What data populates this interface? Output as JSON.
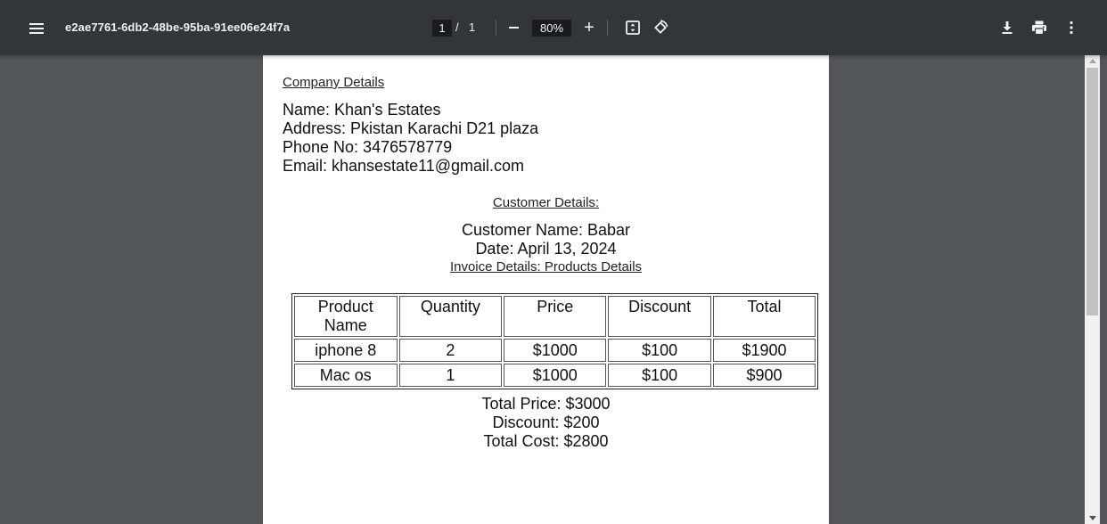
{
  "toolbar": {
    "menu_icon": "menu-icon",
    "document_title": "e2ae7761-6db2-48be-95ba-91ee06e24f7a",
    "current_page": "1",
    "page_separator": "/",
    "total_pages": "1",
    "zoom_out_icon": "minus-icon",
    "zoom_level": "80%",
    "zoom_in_label": "+",
    "fit_icon": "fit-to-page-icon",
    "rotate_icon": "rotate-icon",
    "download_icon": "download-icon",
    "print_icon": "print-icon",
    "more_icon": "more-vertical-icon"
  },
  "document": {
    "company_heading": "Company Details",
    "company_lines": [
      "Name: Khan's Estates",
      "Address: Pkistan Karachi D21 plaza",
      "Phone No: 3476578779",
      "Email: khansestate11@gmail.com"
    ],
    "customer_heading": "Customer Details:",
    "customer_lines": [
      "Customer Name: Babar",
      "Date: April 13, 2024"
    ],
    "invoice_heading": "Invoice Details: Products Details",
    "table": {
      "headers": [
        "Product Name",
        "Quantity",
        "Price",
        "Discount",
        "Total"
      ],
      "rows": [
        [
          "iphone 8",
          "2",
          "$1000",
          "$100",
          "$1900"
        ],
        [
          "Mac os",
          "1",
          "$1000",
          "$100",
          "$900"
        ]
      ]
    },
    "totals": [
      "Total Price: $3000",
      "Discount: $200",
      "Total Cost: $2800"
    ]
  },
  "colors": {
    "toolbar_bg": "#323639",
    "viewer_bg": "#525659",
    "paper_bg": "#ffffff"
  }
}
